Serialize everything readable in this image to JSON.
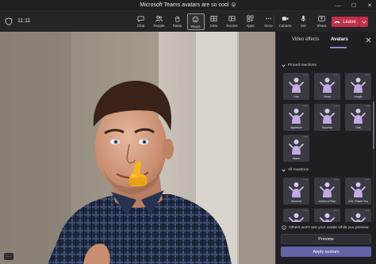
{
  "window": {
    "title": "Microsoft Teams avatars are so cool",
    "title_emoji": "😮",
    "controls": [
      "—",
      "☐",
      "✕"
    ]
  },
  "toolbar": {
    "timer": "11:11",
    "buttons": [
      {
        "label": "Chat",
        "icon": "chat-icon"
      },
      {
        "label": "People",
        "icon": "people-icon"
      },
      {
        "label": "Raise",
        "icon": "raise-hand-icon"
      },
      {
        "label": "React",
        "icon": "react-icon",
        "active": true
      },
      {
        "label": "View",
        "icon": "view-icon"
      },
      {
        "label": "Rooms",
        "icon": "rooms-icon"
      },
      {
        "label": "Apps",
        "icon": "apps-icon"
      },
      {
        "label": "More",
        "icon": "more-icon"
      }
    ],
    "media_buttons": [
      {
        "label": "Camera",
        "icon": "camera-icon"
      },
      {
        "label": "Mic",
        "icon": "mic-icon"
      },
      {
        "label": "Share",
        "icon": "share-icon"
      }
    ],
    "leave_label": "Leave",
    "leave_color": "#c4314b"
  },
  "video": {
    "reaction_emoji": "👍",
    "more_label": "···"
  },
  "panel": {
    "tabs": [
      "Video effects",
      "Avatars"
    ],
    "active_tab": "Avatars",
    "pinned_title": "Pinned reactions",
    "pinned": [
      "Like",
      "Heart",
      "Laugh",
      "Applause",
      "Surprise",
      "Dab",
      "Wave"
    ],
    "all_title": "All reactions",
    "all": [
      "Amused",
      "Armlocal Bow",
      "ASL Thank You",
      "",
      "",
      ""
    ],
    "info_text": "Others won't see your avatar while you preview.",
    "preview_label": "Preview",
    "apply_label": "Apply avatars",
    "accent": "#6264a7"
  }
}
